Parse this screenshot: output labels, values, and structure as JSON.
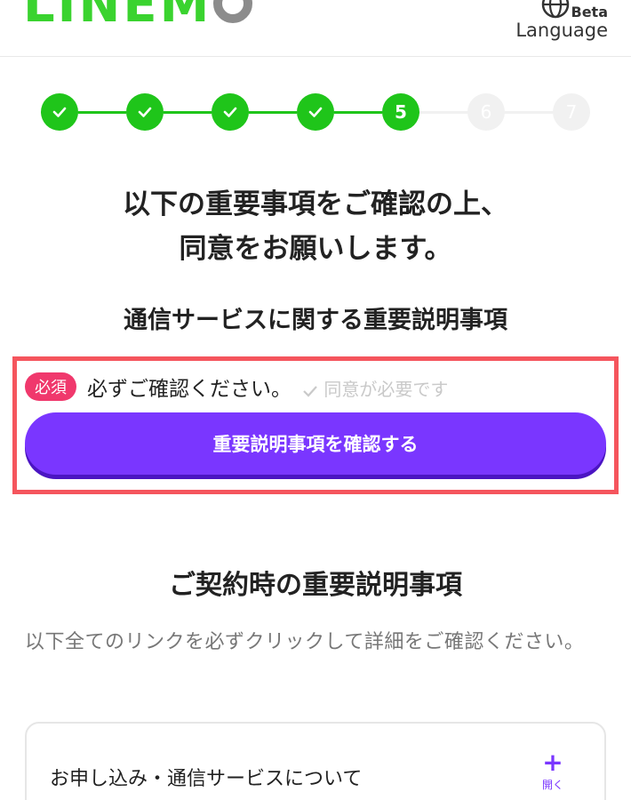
{
  "header": {
    "logo_text": "LINEM",
    "language": {
      "beta_label": "Beta",
      "label": "Language",
      "icon": "globe-icon"
    }
  },
  "stepper": {
    "steps": [
      {
        "number": "1",
        "status": "done"
      },
      {
        "number": "2",
        "status": "done"
      },
      {
        "number": "3",
        "status": "done"
      },
      {
        "number": "4",
        "status": "done"
      },
      {
        "number": "5",
        "status": "current"
      },
      {
        "number": "6",
        "status": "todo"
      },
      {
        "number": "7",
        "status": "todo"
      }
    ],
    "colors": {
      "done": "#1fc51a",
      "todo": "#f1f1f1"
    }
  },
  "page": {
    "title_line1": "以下の重要事項をご確認の上、",
    "title_line2": "同意をお願いします。"
  },
  "section_service": {
    "title": "通信サービスに関する重要説明事項",
    "required_badge": "必須",
    "required_text": "必ずご確認ください。",
    "agreement_status": "同意が必要です",
    "confirm_button": "重要説明事項を確認する",
    "accent_color": "#7a36ff",
    "highlight_color": "#f5555d"
  },
  "section_contract": {
    "title": "ご契約時の重要説明事項",
    "description": "以下全てのリンクを必ずクリックして詳細をご確認ください。",
    "accordion": {
      "label": "お申し込み・通信サービスについて",
      "toggle_icon": "+",
      "toggle_label": "開く"
    }
  }
}
